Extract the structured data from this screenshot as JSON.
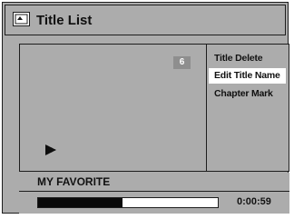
{
  "header": {
    "title": "Title List",
    "icon": "title-list-icon"
  },
  "preview": {
    "title_number": "6",
    "play_icon": "play-icon"
  },
  "menu": {
    "items": [
      {
        "label": "Title Delete",
        "selected": false
      },
      {
        "label": "Edit Title Name",
        "selected": true
      },
      {
        "label": "Chapter Mark",
        "selected": false
      }
    ]
  },
  "title_name": "MY FAVORITE",
  "playback": {
    "progress_fraction": 0.47,
    "time": "0:00:59"
  },
  "colors": {
    "background": "#c6c6c6",
    "highlight": "#ffffff",
    "progress_fill": "#0a0a0a",
    "number_badge": "#8e8e8e"
  }
}
